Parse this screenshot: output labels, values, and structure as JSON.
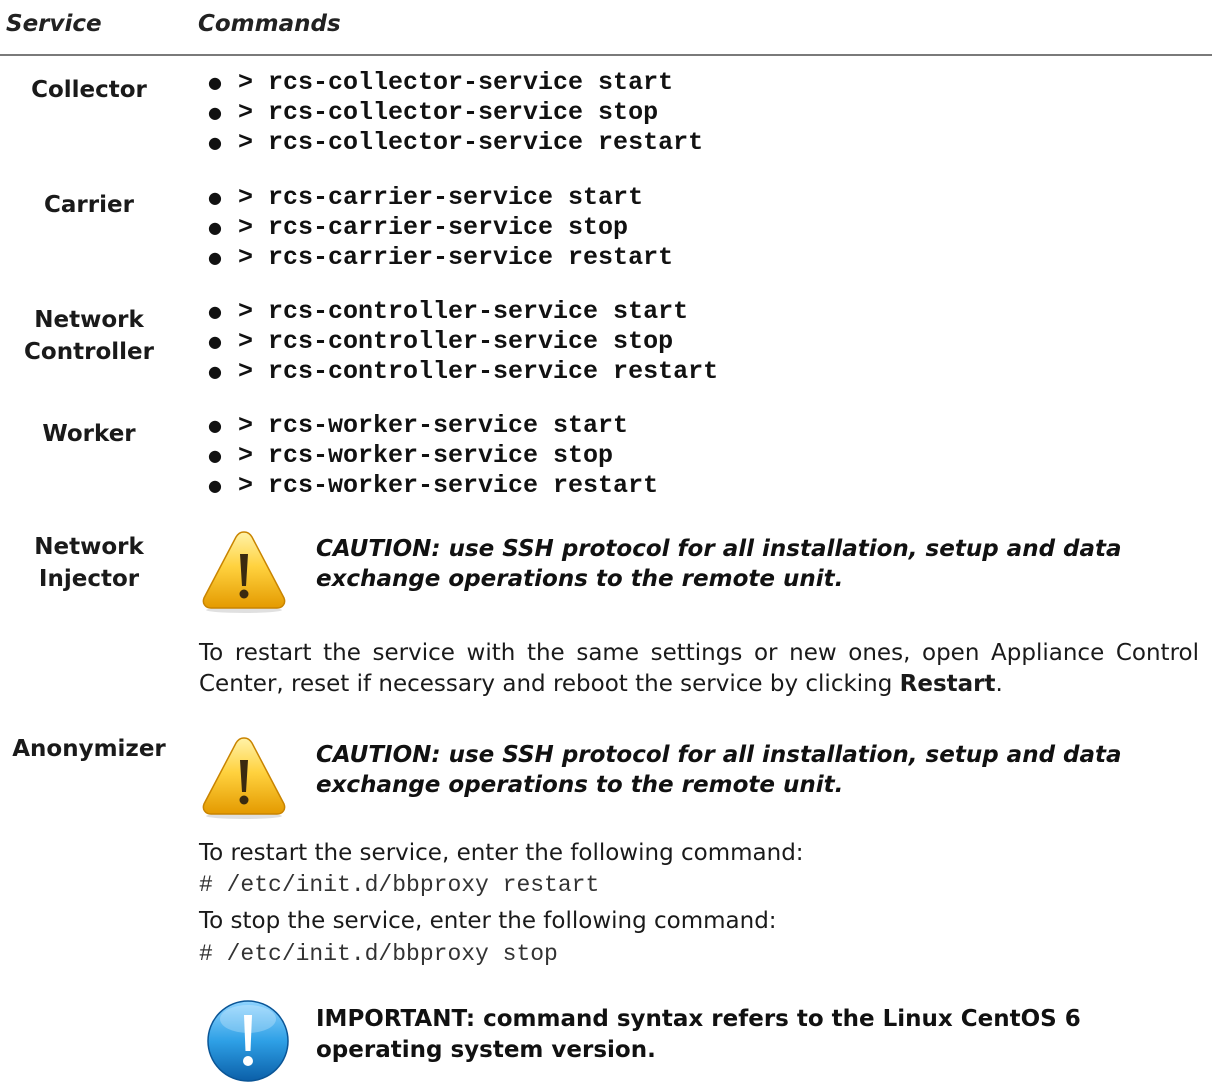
{
  "header": {
    "service": "Service",
    "commands": "Commands"
  },
  "services": [
    {
      "label": "Collector",
      "commands": [
        "> rcs-collector-service start",
        "> rcs-collector-service stop",
        "> rcs-collector-service restart"
      ]
    },
    {
      "label": "Carrier",
      "commands": [
        "> rcs-carrier-service start",
        "> rcs-carrier-service stop",
        "> rcs-carrier-service restart"
      ]
    },
    {
      "label_line1": "Network",
      "label_line2": "Controller",
      "commands": [
        "> rcs-controller-service start",
        "> rcs-controller-service stop",
        "> rcs-controller-service restart"
      ]
    },
    {
      "label": "Worker",
      "commands": [
        "> rcs-worker-service start",
        "> rcs-worker-service stop",
        "> rcs-worker-service restart"
      ]
    }
  ],
  "network_injector": {
    "label_line1": "Network",
    "label_line2": "Injector",
    "caution_line1": "CAUTION: use SSH protocol for all installation, setup and data",
    "caution_line2": "exchange operations to the remote unit.",
    "restart_text": "To restart the service with the same settings or new ones, open Appliance Control Center, reset if necessary and reboot the service by clicking ",
    "restart_bold": "Restart",
    "restart_end": "."
  },
  "anonymizer": {
    "label": "Anonymizer",
    "caution_line1": "CAUTION: use SSH protocol for all installation, setup and data",
    "caution_line2": "exchange operations to the remote unit.",
    "restart_intro": "To restart the service, enter the following command:",
    "restart_cmd": "# /etc/init.d/bbproxy restart",
    "stop_intro": "To stop the service, enter the following command:",
    "stop_cmd": "# /etc/init.d/bbproxy stop",
    "important_line1": "IMPORTANT: command syntax refers to the Linux CentOS 6",
    "important_line2": "operating system version."
  },
  "icons": {
    "warning": "warning-triangle-icon",
    "important": "exclamation-info-icon"
  },
  "colors": {
    "warning_fill": "#f4b400",
    "info_fill": "#1f8fd6",
    "rule": "#7a7a7a"
  }
}
